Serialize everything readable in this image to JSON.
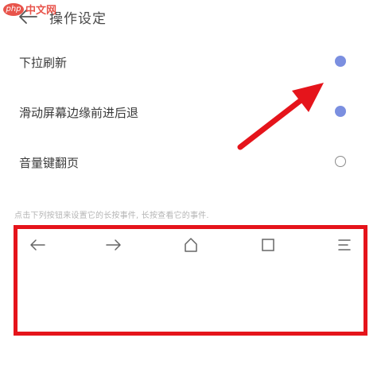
{
  "watermark": {
    "badge": "php",
    "text": "中文网"
  },
  "header": {
    "title": "操作设定"
  },
  "settings": [
    {
      "label": "下拉刷新",
      "enabled": true
    },
    {
      "label": "滑动屏幕边缘前进后退",
      "enabled": true
    },
    {
      "label": "音量键翻页",
      "enabled": false
    }
  ],
  "hint": "点击下列按钮来设置它的长按事件, 长按查看它的事件.",
  "navbar": {
    "icons": [
      "arrow-left-icon",
      "arrow-right-icon",
      "home-icon",
      "tabs-square-icon",
      "menu-icon"
    ]
  },
  "colors": {
    "accent": "#7b8fe0",
    "annotation_red": "#e5141b"
  }
}
